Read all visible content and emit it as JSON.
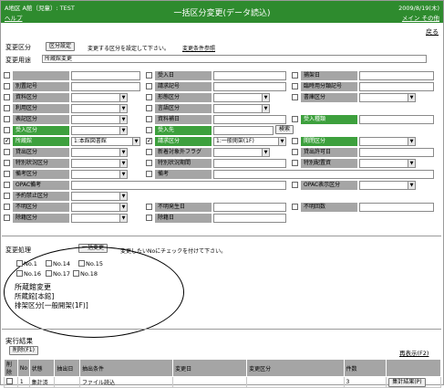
{
  "header": {
    "library": "A地区 A館（児童）: TEST",
    "help": "ヘルプ",
    "title": "一括区分変更(データ読込)",
    "date": "2009/8/19(木)",
    "menu": "メイン その他"
  },
  "back_link": "戻る",
  "change_section": {
    "label": "変更区分",
    "button": "区分設定",
    "note": "変更する区分を設定して下さい。",
    "link": "変更条件参照",
    "purpose_label": "変更用途",
    "purpose_value": "所蔵館変更"
  },
  "fields": {
    "r1": [
      "",
      "受入日",
      "捕架日"
    ],
    "r2": [
      "別置記号",
      "請求記号",
      "臨時用分類記号"
    ],
    "r3": [
      "資料区分",
      "形態区分",
      "書庫区分"
    ],
    "r4": [
      "利用区分",
      "言語区分",
      ""
    ],
    "r5": [
      "表記区分",
      "資料補日",
      "受入種類"
    ],
    "r6": [
      "受入区分",
      "受入先",
      "検索"
    ],
    "r7": [
      "所蔵館",
      "1:本館図書館",
      "請求区分",
      "1:一般開架(1F)",
      "開閉区分"
    ],
    "r8": [
      "貸出区分",
      "新着対象外フラグ",
      "貸出許可日"
    ],
    "r9": [
      "特別状況区分",
      "特別状況期間",
      "特別配置資"
    ],
    "r10": [
      "備考区分",
      "備考"
    ],
    "r11": [
      "OPAC備考",
      "OPAC表示区分"
    ],
    "r12": [
      "予約禁止区分"
    ],
    "r13": [
      "不明区分",
      "不明発生日",
      "不明回数"
    ],
    "r14": [
      "除籍区分",
      "除籍日"
    ]
  },
  "bulk": {
    "label": "変更処理",
    "button": "一括変更",
    "note": "変更したいNoにチェックを付けて下さい。",
    "items_row1": [
      "No.1",
      "No.14",
      "No.15"
    ],
    "items_row2": [
      "No.16",
      "No.17",
      "No.18"
    ],
    "sub_title": "所蔵館変更",
    "line1": "所蔵館[本館]",
    "line2": "排架区分[一般開架(1F)]"
  },
  "result": {
    "title": "実行結果",
    "delete_button": "削除(F1)",
    "redisplay": "再表示(F2)",
    "columns": [
      "削除",
      "No",
      "状態",
      "抽出日",
      "抽出条件",
      "変更日",
      "変更区分",
      "件数",
      ""
    ],
    "row": [
      "",
      "1",
      "集計済",
      "",
      "ファイル読込",
      "",
      "",
      "3",
      "集計結果(P)"
    ]
  }
}
